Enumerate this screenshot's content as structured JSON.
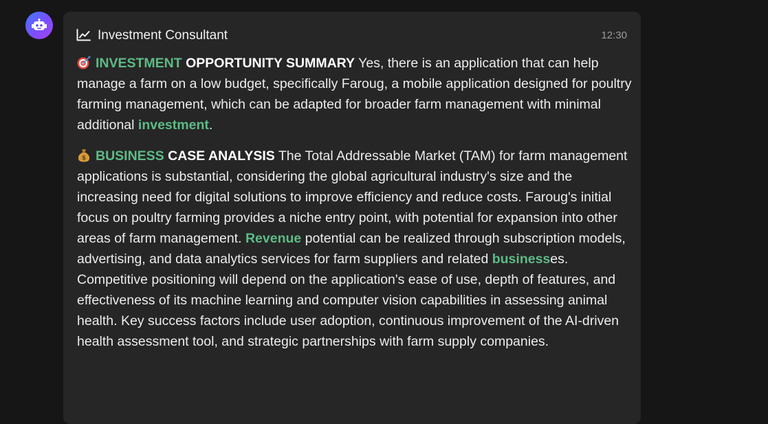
{
  "message": {
    "title": "Investment Consultant",
    "timestamp": "12:30",
    "icons": {
      "avatar": "robot-icon",
      "header": "chart-line-icon",
      "section1": "dart-target-emoji",
      "section2": "money-bag-emoji"
    },
    "colors": {
      "accent": "#5dbb86",
      "bubble": "#262626",
      "background": "#161616"
    },
    "section1": {
      "heading_highlight": "INVESTMENT",
      "heading_rest": "OPPORTUNITY SUMMARY",
      "body_1": " Yes, there is an application that can help manage a farm on a low budget, specifically Faroug, a mobile application designed for poultry farming management, which can be adapted for broader farm management with minimal additional ",
      "highlight_1": "investment",
      "body_2": "."
    },
    "section2": {
      "heading_highlight": "BUSINESS",
      "heading_rest": "CASE ANALYSIS",
      "body_1": " The Total Addressable Market (TAM) for farm management applications is substantial, considering the global agricultural industry's size and the increasing need for digital solutions to improve efficiency and reduce costs. Faroug's initial focus on poultry farming provides a niche entry point, with potential for expansion into other areas of farm management. ",
      "highlight_1": "Revenue",
      "body_2": " potential can be realized through subscription models, advertising, and data analytics services for farm suppliers and related ",
      "highlight_2": "business",
      "body_3": "es. Competitive positioning will depend on the application's ease of use, depth of features, and effectiveness of its machine learning and computer vision capabilities in assessing animal health. Key success factors include user adoption, continuous improvement of the AI-driven health assessment tool, and strategic partnerships with farm supply companies."
    }
  }
}
